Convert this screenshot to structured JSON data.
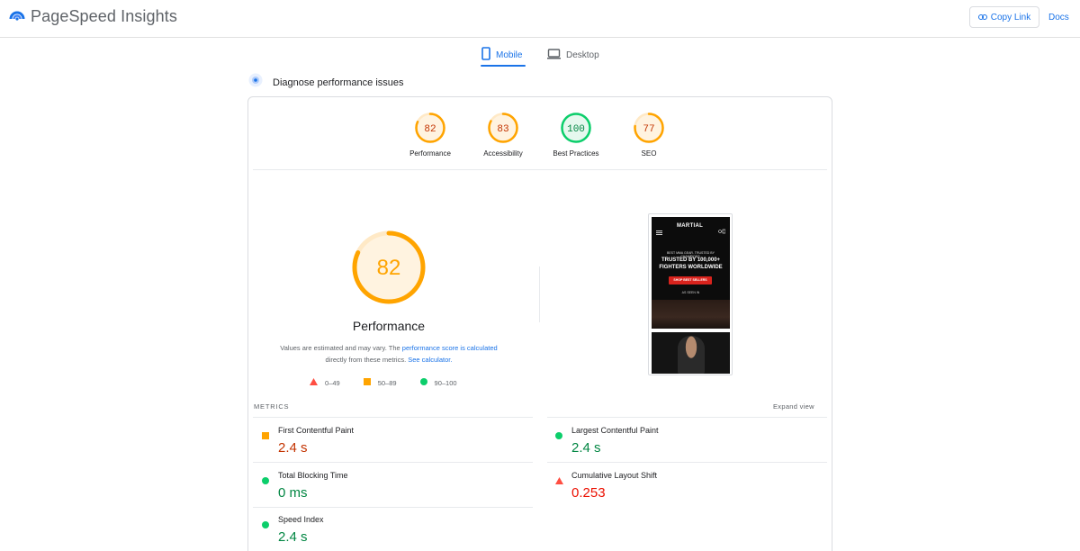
{
  "header": {
    "title": "PageSpeed Insights",
    "copy_link": "Copy Link",
    "docs": "Docs"
  },
  "tabs": [
    {
      "label": "Mobile",
      "active": true
    },
    {
      "label": "Desktop",
      "active": false
    }
  ],
  "diagnose": {
    "title": "Diagnose performance issues"
  },
  "scores": [
    {
      "label": "Performance",
      "value": "82",
      "rating": "average"
    },
    {
      "label": "Accessibility",
      "value": "83",
      "rating": "average"
    },
    {
      "label": "Best Practices",
      "value": "100",
      "rating": "pass"
    },
    {
      "label": "SEO",
      "value": "77",
      "rating": "average"
    }
  ],
  "colors": {
    "pass": "#0cce6b",
    "average": "#ffa400",
    "fail": "#ff4e42",
    "link": "#1a73e8"
  },
  "performance": {
    "score": "82",
    "title": "Performance",
    "note_prefix": "Values are estimated and may vary. The",
    "note_link1": "performance score is calculated",
    "note_mid": "directly from these metrics.",
    "note_link2": "See calculator."
  },
  "legend": [
    {
      "range": "0–49",
      "shape": "triangle-icon"
    },
    {
      "range": "50–89",
      "shape": "square-icon"
    },
    {
      "range": "90–100",
      "shape": "circle-icon"
    }
  ],
  "screenshot": {
    "logo": "MARTIAL",
    "small_text": "BEST MMA GEAR. TRUSTED BY CHAMPIONS.",
    "headline_line1": "TRUSTED BY 100,000+",
    "headline_line2": "FIGHTERS WORLDWIDE",
    "button": "SHOP BEST SELLERS",
    "seen_in": "AS SEEN IN"
  },
  "metrics": {
    "label": "METRICS",
    "expand": "Expand view",
    "items": [
      {
        "name": "First Contentful Paint",
        "value": "2.4 s",
        "rating": "average"
      },
      {
        "name": "Largest Contentful Paint",
        "value": "2.4 s",
        "rating": "pass"
      },
      {
        "name": "Total Blocking Time",
        "value": "0 ms",
        "rating": "pass"
      },
      {
        "name": "Cumulative Layout Shift",
        "value": "0.253",
        "rating": "fail"
      },
      {
        "name": "Speed Index",
        "value": "2.4 s",
        "rating": "pass"
      }
    ]
  }
}
